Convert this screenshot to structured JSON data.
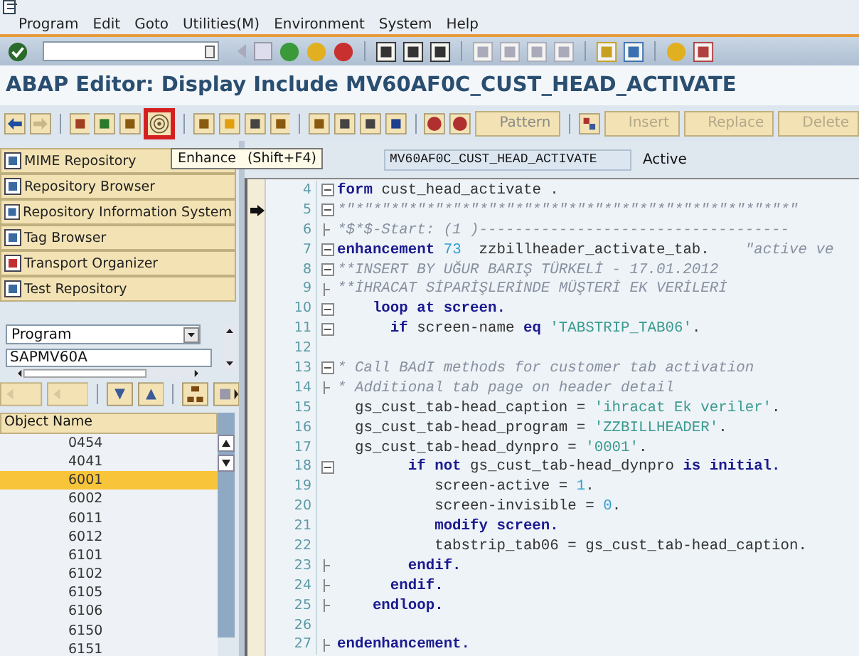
{
  "menu": [
    "Program",
    "Edit",
    "Goto",
    "Utilities(M)",
    "Environment",
    "System",
    "Help"
  ],
  "title": "ABAP Editor: Display Include MV60AF0C_CUST_HEAD_ACTIVATE",
  "app_toolbar": {
    "enhance_button": {
      "highlighted": true
    },
    "text_buttons": [
      {
        "label": "Pattern",
        "disabled": false
      },
      {
        "label": "Insert",
        "disabled": true
      },
      {
        "label": "Replace",
        "disabled": true
      },
      {
        "label": "Delete",
        "disabled": true
      }
    ]
  },
  "tooltip": {
    "label": "Enhance",
    "shortcut": "(Shift+F4)"
  },
  "navigator": [
    {
      "label": "MIME Repository"
    },
    {
      "label": "Repository Browser"
    },
    {
      "label": "Repository Information System"
    },
    {
      "label": "Tag Browser"
    },
    {
      "label": "Transport Organizer"
    },
    {
      "label": "Test Repository"
    }
  ],
  "object_type": {
    "value": "Program"
  },
  "object_field": {
    "value": "SAPMV60A"
  },
  "object_list": {
    "header": "Object Name",
    "items": [
      {
        "name": "0454",
        "selected": false
      },
      {
        "name": "4041",
        "selected": false
      },
      {
        "name": "6001",
        "selected": true
      },
      {
        "name": "6002",
        "selected": false
      },
      {
        "name": "6011",
        "selected": false
      },
      {
        "name": "6012",
        "selected": false
      },
      {
        "name": "6101",
        "selected": false
      },
      {
        "name": "6102",
        "selected": false
      },
      {
        "name": "6105",
        "selected": false
      },
      {
        "name": "6106",
        "selected": false
      },
      {
        "name": "6150",
        "selected": false
      },
      {
        "name": "6151",
        "selected": false
      }
    ]
  },
  "include_field": {
    "value": "MV60AF0C_CUST_HEAD_ACTIVATE"
  },
  "status": "Active",
  "code_lines": [
    {
      "number": "4",
      "kind": "block",
      "current": false,
      "tokens": [
        {
          "kind": "keyword",
          "text": "form "
        },
        {
          "kind": "plain",
          "text": "cust_head_activate ."
        }
      ]
    },
    {
      "number": "5",
      "kind": "block",
      "current": true,
      "tokens": [
        {
          "kind": "comment",
          "text": "*\"*\"*\"*\"*\"*\"*\"*\"*\"*\"*\"*\"*\"*\"*\"*\"*\"*\"*\"*\"*\"*\"*\"*\"*\"*\""
        }
      ]
    },
    {
      "number": "6",
      "kind": "branch",
      "current": false,
      "tokens": [
        {
          "kind": "comment",
          "text": "*$*$-Start: (1 )-----------------------------------"
        }
      ]
    },
    {
      "number": "7",
      "kind": "block",
      "current": false,
      "tokens": [
        {
          "kind": "keyword",
          "text": "enhancement "
        },
        {
          "kind": "number",
          "text": "73"
        },
        {
          "kind": "plain",
          "text": "  zzbillheader_activate_tab.    "
        },
        {
          "kind": "comment",
          "text": "\"active ve"
        }
      ]
    },
    {
      "number": "8",
      "kind": "block",
      "current": false,
      "tokens": [
        {
          "kind": "comment",
          "text": "**INSERT BY UĞUR BARIŞ TÜRKELİ - 17.01.2012"
        }
      ]
    },
    {
      "number": "9",
      "kind": "branch",
      "current": false,
      "tokens": [
        {
          "kind": "comment",
          "text": "**İHRACAT SİPARİŞLERİNDE MÜŞTERİ EK VERİLERİ"
        }
      ]
    },
    {
      "number": "10",
      "kind": "block",
      "current": false,
      "tokens": [
        {
          "kind": "keyword",
          "text": "    loop at screen."
        }
      ]
    },
    {
      "number": "11",
      "kind": "block",
      "current": false,
      "tokens": [
        {
          "kind": "keyword",
          "text": "      if "
        },
        {
          "kind": "plain",
          "text": "screen-name "
        },
        {
          "kind": "keyword",
          "text": "eq "
        },
        {
          "kind": "string",
          "text": "'TABSTRIP_TAB06'"
        },
        {
          "kind": "plain",
          "text": "."
        }
      ]
    },
    {
      "number": "12",
      "kind": "plain",
      "current": false
    },
    {
      "number": "13",
      "kind": "block",
      "current": false,
      "tokens": [
        {
          "kind": "comment",
          "text": "* Call BAdI methods for customer tab activation"
        }
      ]
    },
    {
      "number": "14",
      "kind": "branch",
      "current": false,
      "tokens": [
        {
          "kind": "comment",
          "text": "* Additional tab page on header detail"
        }
      ]
    },
    {
      "number": "15",
      "kind": "plain",
      "current": false,
      "tokens": [
        {
          "kind": "plain",
          "text": "  gs_cust_tab-head_caption = "
        },
        {
          "kind": "string",
          "text": "'ihracat Ek veriler'"
        },
        {
          "kind": "plain",
          "text": "."
        }
      ]
    },
    {
      "number": "16",
      "kind": "plain",
      "current": false,
      "tokens": [
        {
          "kind": "plain",
          "text": "  gs_cust_tab-head_program = "
        },
        {
          "kind": "string",
          "text": "'ZZBILLHEADER'"
        },
        {
          "kind": "plain",
          "text": "."
        }
      ]
    },
    {
      "number": "17",
      "kind": "plain",
      "current": false,
      "tokens": [
        {
          "kind": "plain",
          "text": "  gs_cust_tab-head_dynpro = "
        },
        {
          "kind": "string",
          "text": "'0001'"
        },
        {
          "kind": "plain",
          "text": "."
        }
      ]
    },
    {
      "number": "18",
      "kind": "block",
      "current": false,
      "tokens": [
        {
          "kind": "keyword",
          "text": "        if not "
        },
        {
          "kind": "plain",
          "text": "gs_cust_tab-head_dynpro "
        },
        {
          "kind": "keyword",
          "text": "is initial."
        }
      ]
    },
    {
      "number": "19",
      "kind": "plain",
      "current": false,
      "tokens": [
        {
          "kind": "plain",
          "text": "           screen-active = "
        },
        {
          "kind": "number",
          "text": "1"
        },
        {
          "kind": "plain",
          "text": "."
        }
      ]
    },
    {
      "number": "20",
      "kind": "plain",
      "current": false,
      "tokens": [
        {
          "kind": "plain",
          "text": "           screen-invisible = "
        },
        {
          "kind": "number",
          "text": "0"
        },
        {
          "kind": "plain",
          "text": "."
        }
      ]
    },
    {
      "number": "21",
      "kind": "plain",
      "current": false,
      "tokens": [
        {
          "kind": "keyword",
          "text": "           modify screen."
        }
      ]
    },
    {
      "number": "22",
      "kind": "plain",
      "current": false,
      "tokens": [
        {
          "kind": "plain",
          "text": "           tabstrip_tab06 = gs_cust_tab-head_caption."
        }
      ]
    },
    {
      "number": "23",
      "kind": "branch",
      "current": false,
      "tokens": [
        {
          "kind": "keyword",
          "text": "        endif."
        }
      ]
    },
    {
      "number": "24",
      "kind": "branch",
      "current": false,
      "tokens": [
        {
          "kind": "keyword",
          "text": "      endif."
        }
      ]
    },
    {
      "number": "25",
      "kind": "branch",
      "current": false,
      "tokens": [
        {
          "kind": "keyword",
          "text": "    endloop."
        }
      ]
    },
    {
      "number": "26",
      "kind": "plain",
      "current": false
    },
    {
      "number": "27",
      "kind": "branch",
      "current": false,
      "tokens": [
        {
          "kind": "keyword",
          "text": "endenhancement."
        }
      ]
    }
  ]
}
